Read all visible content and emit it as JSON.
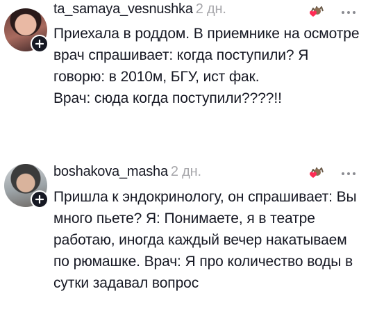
{
  "comments": [
    {
      "username": "ta_samaya_vesnushka",
      "time": "2 дн.",
      "lines": [
        "Приехала в роддом. В приемнике на осмотре врач спрашивает: когда поступили? Я говорю: в 2010м, БГУ, ист фак.",
        "Врач: сюда когда поступили????!!"
      ],
      "avatar_icon": "user-avatar",
      "badge_icon": "plus-icon",
      "reaction_icon": "heart-sticker-icon",
      "more_icon": "more-horizontal-icon"
    },
    {
      "username": "boshakova_masha",
      "time": "2 дн.",
      "lines": [
        "Пришла к эндокринологу, он спрашивает: Вы много пьете? Я: Понимаете, я в театре работаю, иногда каждый вечер накатываем  по рюмашке. Врач: Я про количество воды в сутки задавал вопрос"
      ],
      "avatar_icon": "user-avatar",
      "badge_icon": "plus-icon",
      "reaction_icon": "heart-sticker-icon",
      "more_icon": "more-horizontal-icon"
    }
  ],
  "colors": {
    "text": "#161823",
    "muted": "#a7a7ab",
    "badge": "#161823",
    "heart": "#fe2c55"
  }
}
